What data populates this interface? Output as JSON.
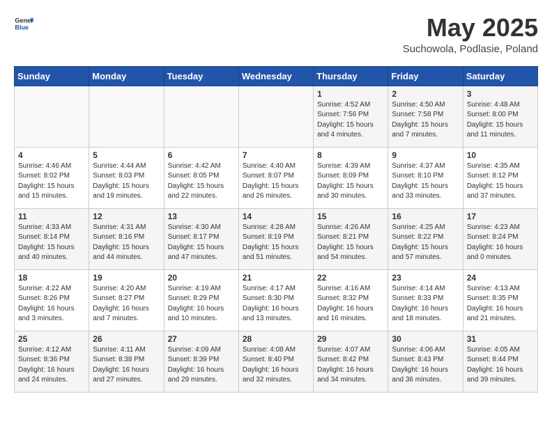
{
  "header": {
    "logo_general": "General",
    "logo_blue": "Blue",
    "month_title": "May 2025",
    "subtitle": "Suchowola, Podlasie, Poland"
  },
  "weekdays": [
    "Sunday",
    "Monday",
    "Tuesday",
    "Wednesday",
    "Thursday",
    "Friday",
    "Saturday"
  ],
  "weeks": [
    [
      {
        "day": "",
        "info": ""
      },
      {
        "day": "",
        "info": ""
      },
      {
        "day": "",
        "info": ""
      },
      {
        "day": "",
        "info": ""
      },
      {
        "day": "1",
        "info": "Sunrise: 4:52 AM\nSunset: 7:56 PM\nDaylight: 15 hours\nand 4 minutes."
      },
      {
        "day": "2",
        "info": "Sunrise: 4:50 AM\nSunset: 7:58 PM\nDaylight: 15 hours\nand 7 minutes."
      },
      {
        "day": "3",
        "info": "Sunrise: 4:48 AM\nSunset: 8:00 PM\nDaylight: 15 hours\nand 11 minutes."
      }
    ],
    [
      {
        "day": "4",
        "info": "Sunrise: 4:46 AM\nSunset: 8:02 PM\nDaylight: 15 hours\nand 15 minutes."
      },
      {
        "day": "5",
        "info": "Sunrise: 4:44 AM\nSunset: 8:03 PM\nDaylight: 15 hours\nand 19 minutes."
      },
      {
        "day": "6",
        "info": "Sunrise: 4:42 AM\nSunset: 8:05 PM\nDaylight: 15 hours\nand 22 minutes."
      },
      {
        "day": "7",
        "info": "Sunrise: 4:40 AM\nSunset: 8:07 PM\nDaylight: 15 hours\nand 26 minutes."
      },
      {
        "day": "8",
        "info": "Sunrise: 4:39 AM\nSunset: 8:09 PM\nDaylight: 15 hours\nand 30 minutes."
      },
      {
        "day": "9",
        "info": "Sunrise: 4:37 AM\nSunset: 8:10 PM\nDaylight: 15 hours\nand 33 minutes."
      },
      {
        "day": "10",
        "info": "Sunrise: 4:35 AM\nSunset: 8:12 PM\nDaylight: 15 hours\nand 37 minutes."
      }
    ],
    [
      {
        "day": "11",
        "info": "Sunrise: 4:33 AM\nSunset: 8:14 PM\nDaylight: 15 hours\nand 40 minutes."
      },
      {
        "day": "12",
        "info": "Sunrise: 4:31 AM\nSunset: 8:16 PM\nDaylight: 15 hours\nand 44 minutes."
      },
      {
        "day": "13",
        "info": "Sunrise: 4:30 AM\nSunset: 8:17 PM\nDaylight: 15 hours\nand 47 minutes."
      },
      {
        "day": "14",
        "info": "Sunrise: 4:28 AM\nSunset: 8:19 PM\nDaylight: 15 hours\nand 51 minutes."
      },
      {
        "day": "15",
        "info": "Sunrise: 4:26 AM\nSunset: 8:21 PM\nDaylight: 15 hours\nand 54 minutes."
      },
      {
        "day": "16",
        "info": "Sunrise: 4:25 AM\nSunset: 8:22 PM\nDaylight: 15 hours\nand 57 minutes."
      },
      {
        "day": "17",
        "info": "Sunrise: 4:23 AM\nSunset: 8:24 PM\nDaylight: 16 hours\nand 0 minutes."
      }
    ],
    [
      {
        "day": "18",
        "info": "Sunrise: 4:22 AM\nSunset: 8:26 PM\nDaylight: 16 hours\nand 3 minutes."
      },
      {
        "day": "19",
        "info": "Sunrise: 4:20 AM\nSunset: 8:27 PM\nDaylight: 16 hours\nand 7 minutes."
      },
      {
        "day": "20",
        "info": "Sunrise: 4:19 AM\nSunset: 8:29 PM\nDaylight: 16 hours\nand 10 minutes."
      },
      {
        "day": "21",
        "info": "Sunrise: 4:17 AM\nSunset: 8:30 PM\nDaylight: 16 hours\nand 13 minutes."
      },
      {
        "day": "22",
        "info": "Sunrise: 4:16 AM\nSunset: 8:32 PM\nDaylight: 16 hours\nand 16 minutes."
      },
      {
        "day": "23",
        "info": "Sunrise: 4:14 AM\nSunset: 8:33 PM\nDaylight: 16 hours\nand 18 minutes."
      },
      {
        "day": "24",
        "info": "Sunrise: 4:13 AM\nSunset: 8:35 PM\nDaylight: 16 hours\nand 21 minutes."
      }
    ],
    [
      {
        "day": "25",
        "info": "Sunrise: 4:12 AM\nSunset: 8:36 PM\nDaylight: 16 hours\nand 24 minutes."
      },
      {
        "day": "26",
        "info": "Sunrise: 4:11 AM\nSunset: 8:38 PM\nDaylight: 16 hours\nand 27 minutes."
      },
      {
        "day": "27",
        "info": "Sunrise: 4:09 AM\nSunset: 8:39 PM\nDaylight: 16 hours\nand 29 minutes."
      },
      {
        "day": "28",
        "info": "Sunrise: 4:08 AM\nSunset: 8:40 PM\nDaylight: 16 hours\nand 32 minutes."
      },
      {
        "day": "29",
        "info": "Sunrise: 4:07 AM\nSunset: 8:42 PM\nDaylight: 16 hours\nand 34 minutes."
      },
      {
        "day": "30",
        "info": "Sunrise: 4:06 AM\nSunset: 8:43 PM\nDaylight: 16 hours\nand 36 minutes."
      },
      {
        "day": "31",
        "info": "Sunrise: 4:05 AM\nSunset: 8:44 PM\nDaylight: 16 hours\nand 39 minutes."
      }
    ]
  ]
}
